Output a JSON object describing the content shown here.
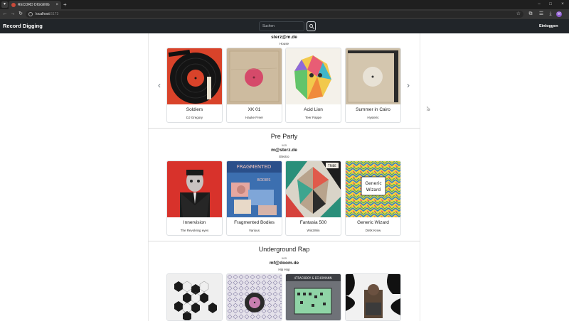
{
  "browser": {
    "tab_title": "RECORD DIGGING",
    "new_tab_glyph": "+",
    "close_glyph": "×",
    "menu_glyph": "▾",
    "url_host": "localhost",
    "url_port": ":5173",
    "nav": {
      "back": "←",
      "forward": "→",
      "reload": "↻"
    },
    "window_controls": {
      "minimize": "–",
      "maximize": "□",
      "close": "×"
    },
    "profile_initial": "M",
    "toolbar_icons": {
      "star": "☆",
      "extensions": "⧉",
      "media": "☰",
      "downloads": "⤓"
    }
  },
  "app": {
    "brand": "Record Digging",
    "search": {
      "placeholder": "Suchen"
    },
    "login_label": "Einloggen"
  },
  "lists": [
    {
      "owner": "sterz@m.de",
      "genre": "House",
      "records": [
        {
          "title": "Soldiers",
          "artist": "DJ Gregory"
        },
        {
          "title": "XK 01",
          "artist": "Hauke Freer"
        },
        {
          "title": "Acid Lion",
          "artist": "Teer Pappe"
        },
        {
          "title": "Summer in Cairo",
          "artist": "Hysteric"
        }
      ],
      "prev_glyph": "‹",
      "next_glyph": "›"
    },
    {
      "title": "Pre Party",
      "by_label": "von",
      "owner": "m@sterz.de",
      "genre": "Electro",
      "records": [
        {
          "title": "Innervision",
          "artist": "The Revolving eyes"
        },
        {
          "title": "Fragmented Bodies",
          "artist": "Various"
        },
        {
          "title": "Fantasia 500",
          "artist": "Win2Win"
        },
        {
          "title": "Generic Wizard",
          "artist": "DMX Krew"
        }
      ],
      "cover_texts": {
        "fragmented": "FRAGMENTED",
        "fragmented_sub": "BODIES",
        "generic_wizard": "Generic Wizard",
        "stamp": "TRIBE"
      }
    },
    {
      "title": "Underground Rap",
      "by_label": "von",
      "owner": "mf@doom.de",
      "genre": "Hip Hop",
      "cover_texts": {
        "tape": "4TRACKBOY & ECHOMANN"
      }
    }
  ],
  "colors": {
    "navbar": "#212529",
    "chrome": "#1f1f1f",
    "toolbar": "#353535",
    "accent_profile": "#8e5bd0"
  }
}
